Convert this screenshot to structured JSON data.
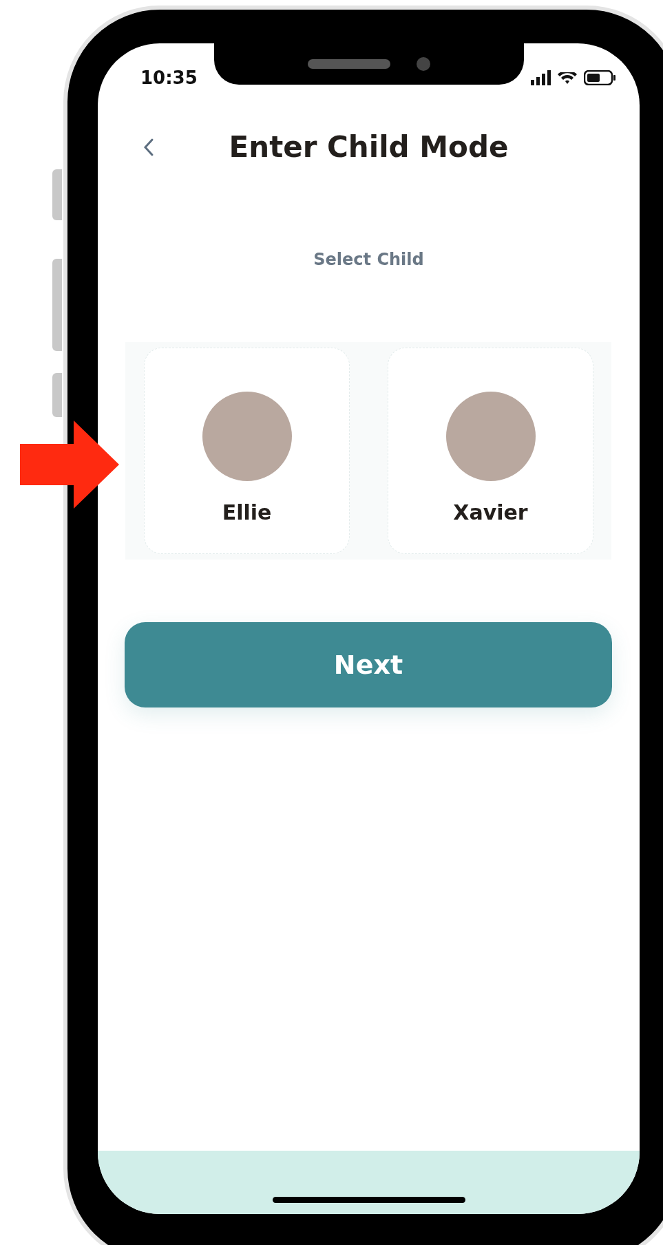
{
  "status_bar": {
    "time": "10:35"
  },
  "header": {
    "title": "Enter Child Mode"
  },
  "subtitle": "Select Child",
  "children": [
    {
      "name": "Ellie",
      "selected": false
    },
    {
      "name": "Xavier",
      "selected": false
    }
  ],
  "next_button": {
    "label": "Next"
  }
}
